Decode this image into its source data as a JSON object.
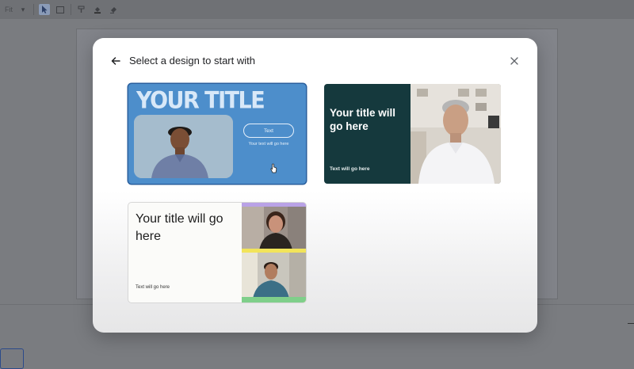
{
  "app": {
    "toolbar_text": "Fit"
  },
  "modal": {
    "title": "Select a design to start with",
    "back_icon": "arrow-back-icon",
    "close_icon": "close-icon"
  },
  "templates": [
    {
      "title": "YOUR TITLE",
      "button_text": "Text",
      "subtitle": "Your text will go here",
      "background": "#4d8ecb",
      "selected": true
    },
    {
      "title": "Your title will go here",
      "subtitle": "Text will go here",
      "background": "#15393d"
    },
    {
      "title": "Your title will go here",
      "subtitle": "Text will go here",
      "background": "#fbfbf9",
      "accent_colors": [
        "#b9a2e6",
        "#f2e45a",
        "#7fcf8a"
      ]
    }
  ]
}
